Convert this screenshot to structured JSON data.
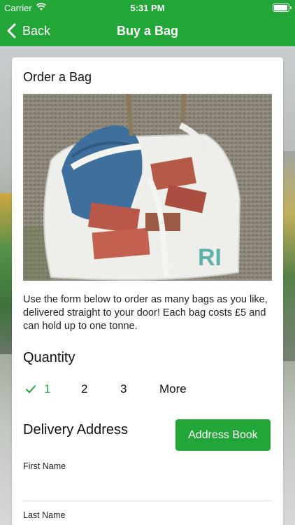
{
  "status_bar": {
    "carrier": "Carrier",
    "time": "5:31 PM"
  },
  "navbar": {
    "back_label": "Back",
    "title": "Buy a Bag"
  },
  "card": {
    "title": "Order a Bag",
    "description": "Use the form below to order as many bags as you like, delivered straight to your door! Each bag costs £5 and can hold up to one tonne."
  },
  "quantity": {
    "title": "Quantity",
    "options": [
      "1",
      "2",
      "3",
      "More"
    ],
    "selected": "1"
  },
  "delivery": {
    "title": "Delivery Address",
    "address_book_label": "Address Book",
    "fields": [
      {
        "label": "First Name",
        "value": ""
      },
      {
        "label": "Last Name",
        "value": ""
      }
    ]
  },
  "colors": {
    "brand_green": "#23a638",
    "text": "#111111"
  },
  "icons": [
    "wifi-icon",
    "battery-icon",
    "back-chevron-icon",
    "checkmark-icon"
  ]
}
